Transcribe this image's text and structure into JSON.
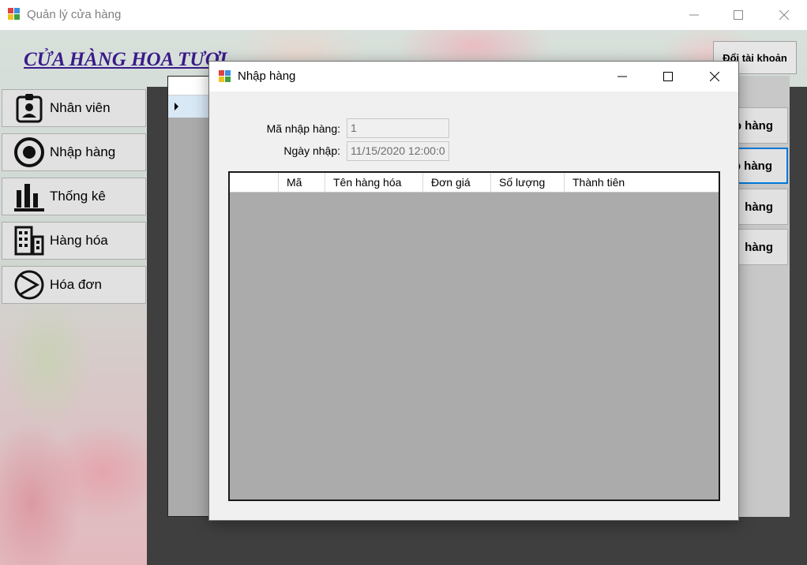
{
  "main_window": {
    "title": "Quản lý cửa hàng",
    "shop_title": "CỬA HÀNG HOA TƯƠI",
    "switch_account": "Đổi tài khoản",
    "nav": [
      {
        "label": "Nhân viên",
        "icon": "employee-badge-icon"
      },
      {
        "label": "Nhập hàng",
        "icon": "target-circle-icon"
      },
      {
        "label": "Thống kê",
        "icon": "bar-chart-icon"
      },
      {
        "label": "Hàng hóa",
        "icon": "buildings-icon"
      },
      {
        "label": "Hóa đơn",
        "icon": "invoice-play-icon"
      }
    ],
    "right_buttons": [
      "p hàng",
      "p hàng",
      "hàng",
      "hàng"
    ]
  },
  "dialog": {
    "title": "Nhập hàng",
    "import_id_label": "Mã nhập hàng:",
    "import_id_value": "1",
    "import_date_label": "Ngày nhập:",
    "import_date_value": "11/15/2020 12:00:0",
    "columns": [
      "Mã",
      "Tên hàng hóa",
      "Đơn giá",
      "Số lượng",
      "Thành tiên"
    ]
  },
  "colors": {
    "shop_title": "#3b1a8a",
    "focus_border": "#0078d7",
    "grid_background": "#ababab",
    "panel_dark": "#3f3f3f"
  }
}
